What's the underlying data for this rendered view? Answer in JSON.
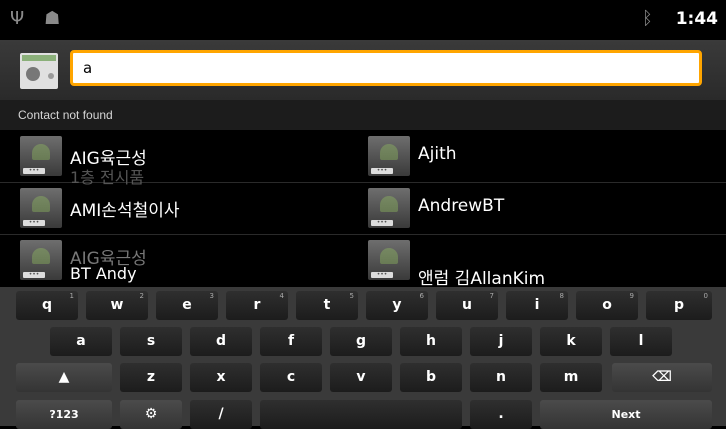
{
  "statusbar": {
    "usb_icon": "usb-icon",
    "android_icon": "android-debug-icon",
    "bt_icon": "bluetooth-icon",
    "time": "1:44"
  },
  "search": {
    "value": "a"
  },
  "not_found_label": "Contact not found",
  "contacts": [
    {
      "name": "AIG육근성",
      "ghost": "1층 전시품"
    },
    {
      "name": "Ajith",
      "ghost": ""
    },
    {
      "name": "AMI손석철이사",
      "ghost": ""
    },
    {
      "name": "AndrewBT",
      "ghost": ""
    },
    {
      "name": "AIG육근성",
      "ghost": "BT Andy"
    },
    {
      "name": "앤럼 김AllanKim",
      "ghost": ""
    }
  ],
  "keyboard": {
    "row1": [
      {
        "k": "q",
        "n": "1"
      },
      {
        "k": "w",
        "n": "2"
      },
      {
        "k": "e",
        "n": "3"
      },
      {
        "k": "r",
        "n": "4"
      },
      {
        "k": "t",
        "n": "5"
      },
      {
        "k": "y",
        "n": "6"
      },
      {
        "k": "u",
        "n": "7"
      },
      {
        "k": "i",
        "n": "8"
      },
      {
        "k": "o",
        "n": "9"
      },
      {
        "k": "p",
        "n": "0"
      }
    ],
    "row2": [
      "a",
      "s",
      "d",
      "f",
      "g",
      "h",
      "j",
      "k",
      "l"
    ],
    "row3": [
      "z",
      "x",
      "c",
      "v",
      "b",
      "n",
      "m"
    ],
    "shift": "▲",
    "backspace": "⌫",
    "sym": "?123",
    "settings": "⚙",
    "slash": "/",
    "period": ".",
    "next": "Next"
  }
}
